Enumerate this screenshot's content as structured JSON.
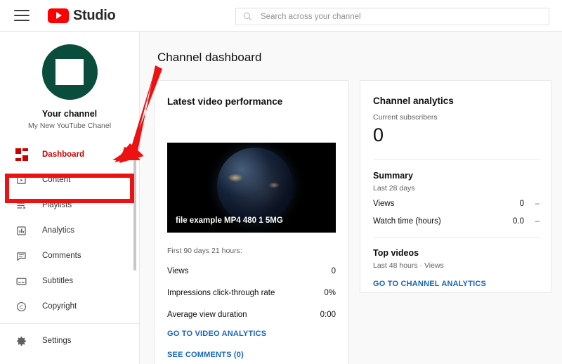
{
  "topbar": {
    "menu_icon": "hamburger-menu-icon",
    "logo_icon": "youtube-logo-icon",
    "brand": "Studio",
    "search": {
      "icon": "search-icon",
      "value": "",
      "placeholder": "Search across your channel"
    }
  },
  "sidebar": {
    "avatar_icon": "channel-avatar",
    "channel_name": "Your channel",
    "channel_description": "My New YouTube Chanel",
    "items": [
      {
        "label": "Dashboard",
        "icon": "dashboard-grid-icon",
        "active": true
      },
      {
        "label": "Content",
        "icon": "content-play-icon",
        "active": false
      },
      {
        "label": "Playlists",
        "icon": "playlists-icon",
        "active": false
      },
      {
        "label": "Analytics",
        "icon": "analytics-bar-chart-icon",
        "active": false
      },
      {
        "label": "Comments",
        "icon": "comments-speech-bubble-icon",
        "active": false
      },
      {
        "label": "Subtitles",
        "icon": "subtitles-icon",
        "active": false
      },
      {
        "label": "Copyright",
        "icon": "copyright-icon",
        "active": false
      }
    ],
    "footer_items": [
      {
        "label": "Settings",
        "icon": "gear-icon"
      }
    ]
  },
  "main": {
    "page_title": "Channel dashboard",
    "latest_video": {
      "title": "Latest video performance",
      "thumbnail_alt": "earth-from-space-thumbnail",
      "video_title": "file example MP4 480 1 5MG",
      "period_label": "First 90 days 21 hours:",
      "stats": [
        {
          "label": "Views",
          "value": "0"
        },
        {
          "label": "Impressions click-through rate",
          "value": "0%"
        },
        {
          "label": "Average view duration",
          "value": "0:00"
        }
      ],
      "links": [
        "GO TO VIDEO ANALYTICS",
        "SEE COMMENTS (0)"
      ]
    },
    "channel_analytics": {
      "title": "Channel analytics",
      "subscribers_label": "Current subscribers",
      "subscribers_value": "0",
      "summary": {
        "title": "Summary",
        "period": "Last 28 days",
        "rows": [
          {
            "label": "Views",
            "value": "0",
            "delta": "–"
          },
          {
            "label": "Watch time (hours)",
            "value": "0.0",
            "delta": "–"
          }
        ]
      },
      "top_videos": {
        "title": "Top videos",
        "period": "Last 48 hours · Views"
      },
      "link": "GO TO CHANNEL ANALYTICS"
    }
  },
  "annotations": {
    "arrow": "red-arrow-pointing-to-content",
    "highlight": "red-highlight-box-around-content",
    "color": "#ee1111"
  }
}
